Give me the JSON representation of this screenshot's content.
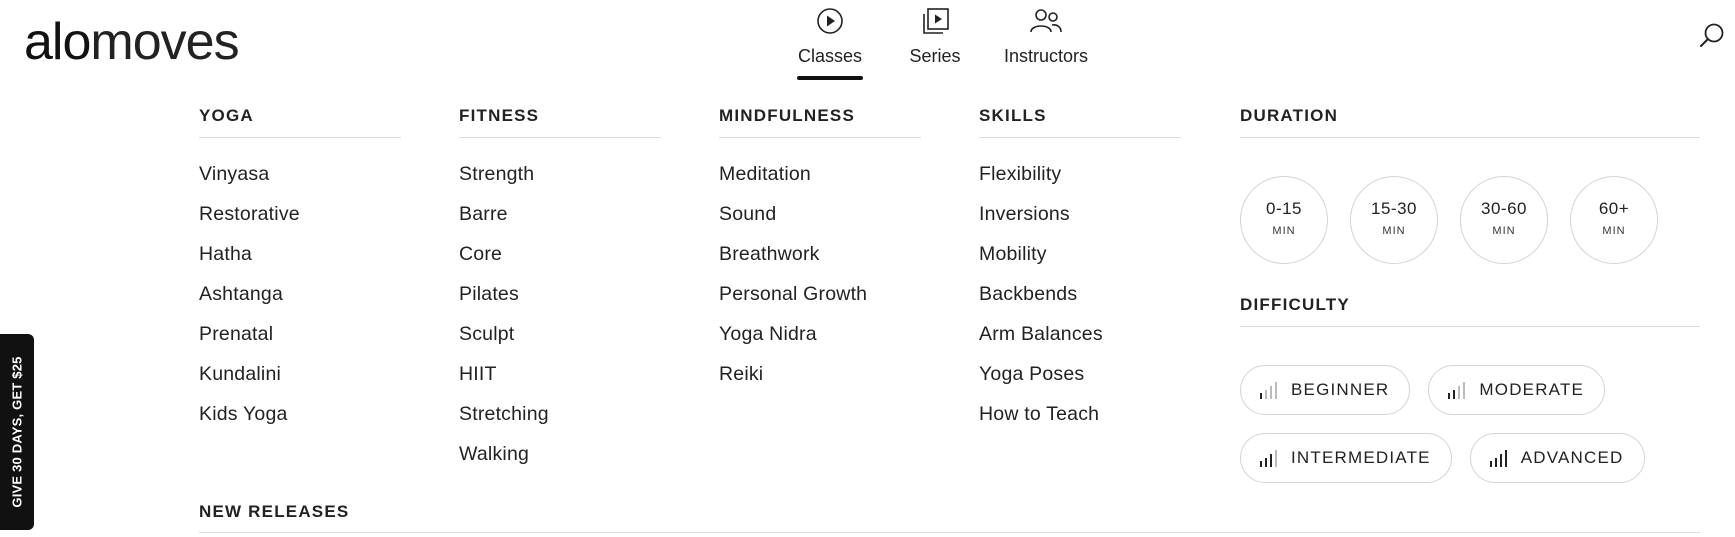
{
  "logo": {
    "bold": "alo",
    "light": "moves"
  },
  "nav": [
    {
      "label": "Classes",
      "icon": "play-circle-icon",
      "active": true
    },
    {
      "label": "Series",
      "icon": "stacked-play-icon",
      "active": false
    },
    {
      "label": "Instructors",
      "icon": "people-icon",
      "active": false
    }
  ],
  "side_tab": "GIVE 30 DAYS, GET $25",
  "columns": [
    {
      "title": "YOGA",
      "items": [
        "Vinyasa",
        "Restorative",
        "Hatha",
        "Ashtanga",
        "Prenatal",
        "Kundalini",
        "Kids Yoga"
      ]
    },
    {
      "title": "FITNESS",
      "items": [
        "Strength",
        "Barre",
        "Core",
        "Pilates",
        "Sculpt",
        "HIIT",
        "Stretching",
        "Walking"
      ]
    },
    {
      "title": "MINDFULNESS",
      "items": [
        "Meditation",
        "Sound",
        "Breathwork",
        "Personal Growth",
        "Yoga Nidra",
        "Reiki"
      ]
    },
    {
      "title": "SKILLS",
      "items": [
        "Flexibility",
        "Inversions",
        "Mobility",
        "Backbends",
        "Arm Balances",
        "Yoga Poses",
        "How to Teach"
      ]
    }
  ],
  "duration": {
    "title": "DURATION",
    "options": [
      {
        "value": "0-15",
        "unit": "MIN"
      },
      {
        "value": "15-30",
        "unit": "MIN"
      },
      {
        "value": "30-60",
        "unit": "MIN"
      },
      {
        "value": "60+",
        "unit": "MIN"
      }
    ]
  },
  "difficulty": {
    "title": "DIFFICULTY",
    "levels": [
      {
        "label": "BEGINNER",
        "bars": 1
      },
      {
        "label": "MODERATE",
        "bars": 2
      },
      {
        "label": "INTERMEDIATE",
        "bars": 3
      },
      {
        "label": "ADVANCED",
        "bars": 4
      }
    ]
  },
  "new_releases": {
    "title": "NEW RELEASES"
  }
}
